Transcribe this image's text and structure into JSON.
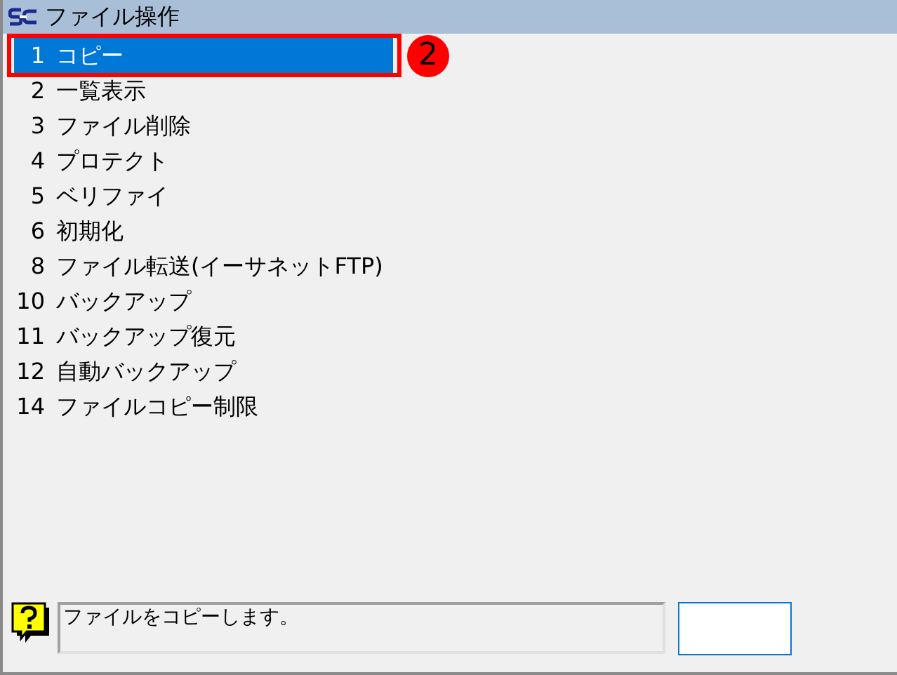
{
  "window": {
    "title": "ファイル操作"
  },
  "menu": {
    "items": [
      {
        "number": "1",
        "label": "コピー",
        "selected": true
      },
      {
        "number": "2",
        "label": "一覧表示",
        "selected": false
      },
      {
        "number": "3",
        "label": "ファイル削除",
        "selected": false
      },
      {
        "number": "4",
        "label": "プロテクト",
        "selected": false
      },
      {
        "number": "5",
        "label": "ベリファイ",
        "selected": false
      },
      {
        "number": "6",
        "label": "初期化",
        "selected": false
      },
      {
        "number": "8",
        "label": "ファイル転送(イーサネットFTP)",
        "selected": false
      },
      {
        "number": "10",
        "label": "バックアップ",
        "selected": false
      },
      {
        "number": "11",
        "label": "バックアップ復元",
        "selected": false
      },
      {
        "number": "12",
        "label": "自動バックアップ",
        "selected": false
      },
      {
        "number": "14",
        "label": "ファイルコピー制限",
        "selected": false
      }
    ]
  },
  "callout": {
    "text": "2"
  },
  "status_bar": {
    "message": "ファイルをコピーします。"
  }
}
